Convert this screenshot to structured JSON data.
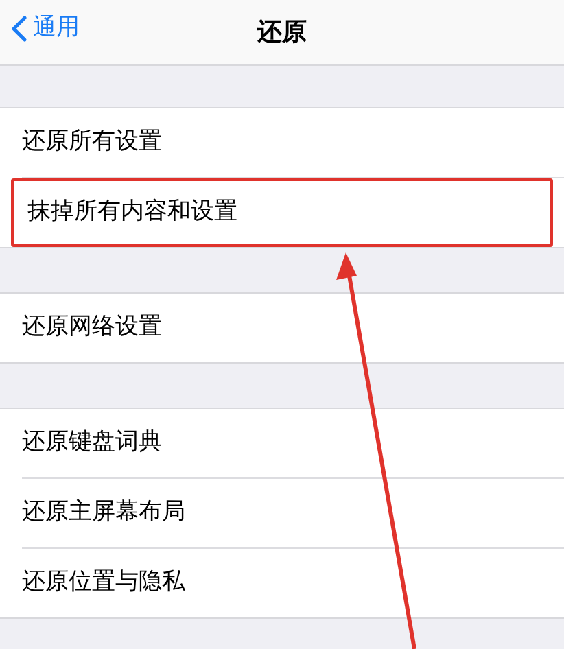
{
  "nav": {
    "back": "通用",
    "title": "还原"
  },
  "groups": [
    {
      "rows": [
        {
          "label": "还原所有设置",
          "highlighted": false
        },
        {
          "label": "抹掉所有内容和设置",
          "highlighted": true
        }
      ]
    },
    {
      "rows": [
        {
          "label": "还原网络设置",
          "highlighted": false
        }
      ]
    },
    {
      "rows": [
        {
          "label": "还原键盘词典",
          "highlighted": false
        },
        {
          "label": "还原主屏幕布局",
          "highlighted": false
        },
        {
          "label": "还原位置与隐私",
          "highlighted": false
        }
      ]
    }
  ]
}
